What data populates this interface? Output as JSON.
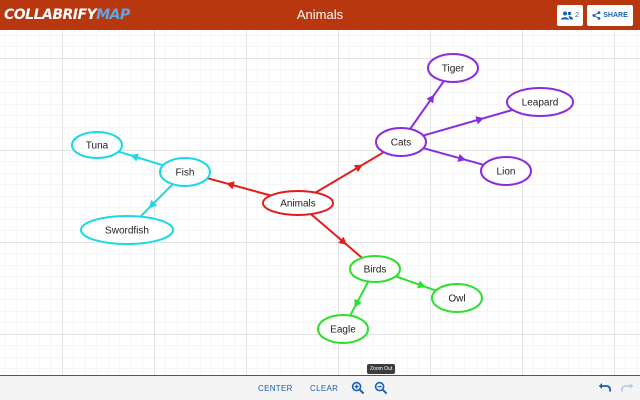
{
  "header": {
    "logo_part1": "COLLABRIFY",
    "logo_part2": "MAP",
    "title": "Animals",
    "users_count": "2",
    "share_label": "SHARE"
  },
  "map": {
    "nodes": [
      {
        "id": "animals",
        "label": "Animals",
        "color": "#e51c1c"
      },
      {
        "id": "cats",
        "label": "Cats",
        "color": "#8a2be2"
      },
      {
        "id": "tiger",
        "label": "Tiger",
        "color": "#8a2be2"
      },
      {
        "id": "leapard",
        "label": "Leapard",
        "color": "#8a2be2"
      },
      {
        "id": "lion",
        "label": "Lion",
        "color": "#8a2be2"
      },
      {
        "id": "fish",
        "label": "Fish",
        "color": "#1ad8e6"
      },
      {
        "id": "tuna",
        "label": "Tuna",
        "color": "#1ad8e6"
      },
      {
        "id": "swordfish",
        "label": "Swordfish",
        "color": "#1ad8e6"
      },
      {
        "id": "birds",
        "label": "Birds",
        "color": "#2ee02e"
      },
      {
        "id": "owl",
        "label": "Owl",
        "color": "#2ee02e"
      },
      {
        "id": "eagle",
        "label": "Eagle",
        "color": "#2ee02e"
      }
    ],
    "edges": [
      {
        "from": "animals",
        "to": "cats",
        "color": "#e51c1c"
      },
      {
        "from": "animals",
        "to": "fish",
        "color": "#e51c1c"
      },
      {
        "from": "animals",
        "to": "birds",
        "color": "#e51c1c"
      },
      {
        "from": "cats",
        "to": "tiger",
        "color": "#8a2be2"
      },
      {
        "from": "cats",
        "to": "leapard",
        "color": "#8a2be2"
      },
      {
        "from": "cats",
        "to": "lion",
        "color": "#8a2be2"
      },
      {
        "from": "fish",
        "to": "tuna",
        "color": "#1ad8e6"
      },
      {
        "from": "fish",
        "to": "swordfish",
        "color": "#1ad8e6"
      },
      {
        "from": "birds",
        "to": "owl",
        "color": "#2ee02e"
      },
      {
        "from": "birds",
        "to": "eagle",
        "color": "#2ee02e"
      }
    ]
  },
  "footer": {
    "center_label": "CENTER",
    "clear_label": "CLEAR",
    "zoom_tooltip": "Zoom Out"
  },
  "colors": {
    "header_bg": "#b8370f",
    "accent": "#1a5fb4",
    "grid": "#d6d6d6"
  }
}
